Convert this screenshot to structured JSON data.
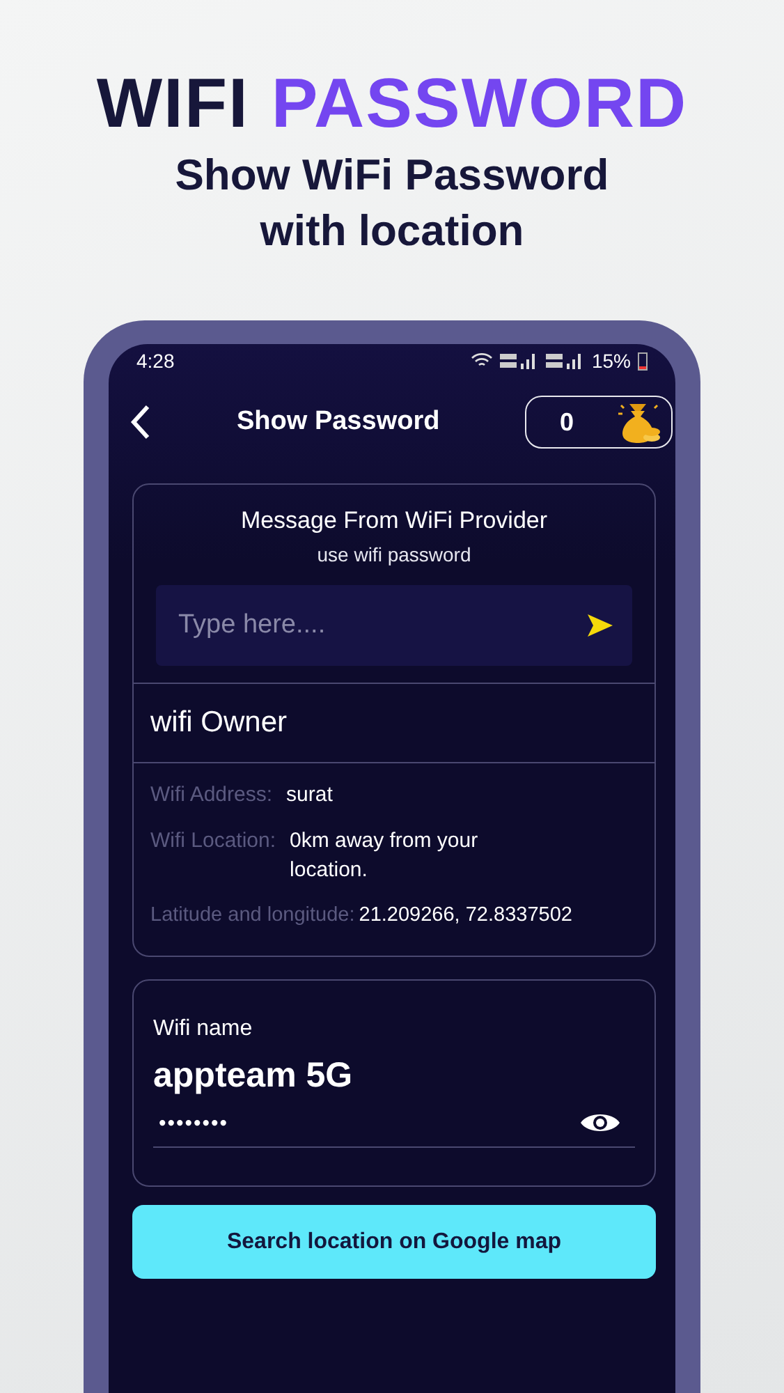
{
  "promo": {
    "headline": [
      {
        "text": "WIFI",
        "color": "#17173a"
      },
      {
        "text": "PASSWORD",
        "color": "#7446f0"
      }
    ],
    "subtitle_lines": [
      "Show WiFi Password",
      "with location"
    ]
  },
  "status_bar": {
    "time": "4:28",
    "battery": "15%"
  },
  "header": {
    "title": "Show Password",
    "coins": "0"
  },
  "message_card": {
    "title": "Message From WiFi Provider",
    "subtitle": "use wifi password",
    "input": {
      "placeholder": "Type here...."
    }
  },
  "owner": {
    "title": "wifi Owner",
    "details": [
      {
        "label": "Wifi Address:",
        "value": "surat"
      },
      {
        "label": "Wifi Location:",
        "value": "0km away from your location."
      },
      {
        "label": "Latitude and longitude:",
        "value": "21.209266, 72.8337502"
      }
    ]
  },
  "wifi_card": {
    "label": "Wifi name",
    "name": "appteam 5G",
    "password": "••••••••"
  },
  "button": "Search location on Google map"
}
